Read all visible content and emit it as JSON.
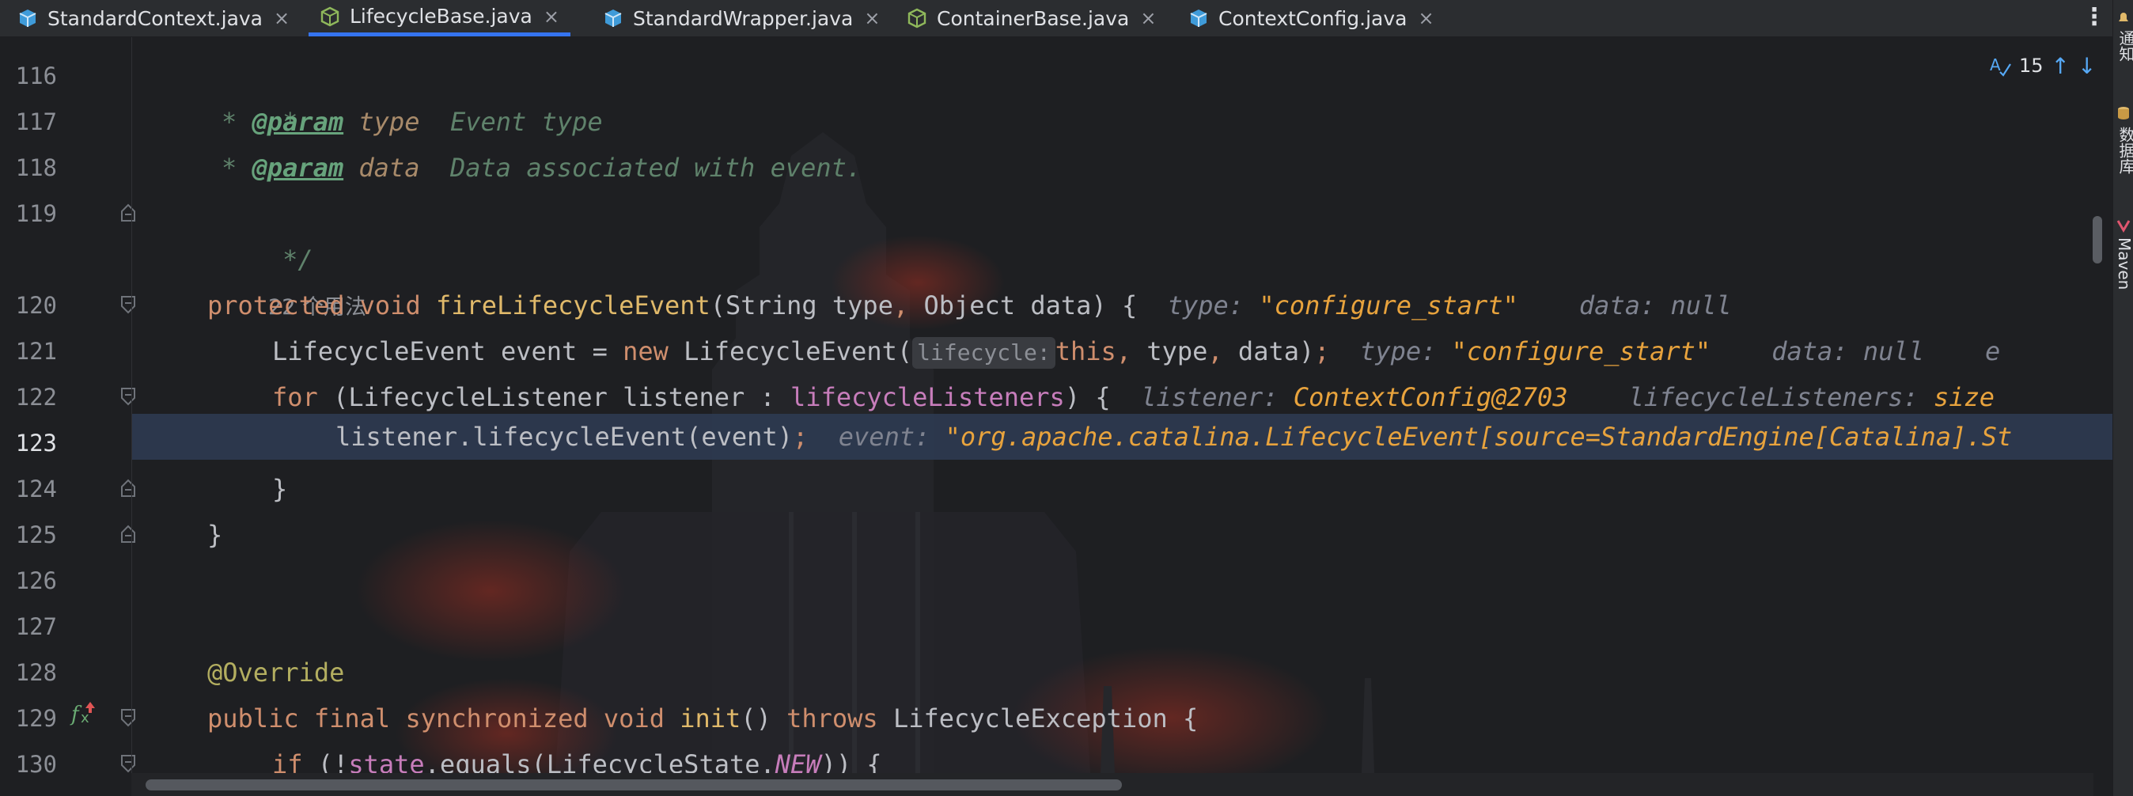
{
  "tabs": [
    {
      "label": "StandardContext.java",
      "icon": "java-class-icon"
    },
    {
      "label": "LifecycleBase.java",
      "icon": "java-abstract-class-icon"
    },
    {
      "label": "StandardWrapper.java",
      "icon": "java-class-icon"
    },
    {
      "label": "ContainerBase.java",
      "icon": "java-abstract-class-icon"
    },
    {
      "label": "ContextConfig.java",
      "icon": "java-class-icon"
    }
  ],
  "active_tab": "LifecycleBase.java",
  "close_glyph": "×",
  "more_glyph": "⋮",
  "inspection": {
    "count": "15",
    "up": "↑",
    "down": "↓"
  },
  "right_strip": [
    "通知",
    "数据库",
    "Maven"
  ],
  "line_numbers": [
    "116",
    "117",
    "118",
    "119",
    "120",
    "121",
    "122",
    "123",
    "124",
    "125",
    "126",
    "127",
    "128",
    "129",
    "130"
  ],
  "current_line": "123",
  "usage_hint": "22 个用法",
  "code": {
    "l116": {
      "star": "*"
    },
    "l117": {
      "star": "* ",
      "tag": "@param",
      "name": "type",
      "desc": "Event type"
    },
    "l118": {
      "star": "* ",
      "tag": "@param",
      "name": "data",
      "desc": "Data associated with event."
    },
    "l119": {
      "end": "*/"
    },
    "l120": {
      "kw1": "protected",
      "kw2": "void",
      "fn": "fireLifecycleEvent",
      "p1": "(String type",
      "comma": ",",
      "p2": " Object data) {",
      "d1k": "type: ",
      "d1v": "\"configure_start\"",
      "d2k": "data: ",
      "d2v": "null"
    },
    "l121": {
      "t": "LifecycleEvent event = ",
      "kw": "new",
      "t2": " LifecycleEvent(",
      "hint": "lifecycle:",
      "kw2": "this",
      "c1": ",",
      "t3": " type",
      "c2": ",",
      "t4": " data)",
      "semi": ";",
      "d1k": "type: ",
      "d1v": "\"configure_start\"",
      "d2k": "data: ",
      "d2v": "null",
      "d3k": "e"
    },
    "l122": {
      "kw": "for",
      "t": " (LifecycleListener listener : ",
      "fld": "lifecycleListeners",
      "t2": ") {",
      "d1k": "listener: ",
      "d1v": "ContextConfig@2703",
      "d2k": "lifecycleListeners: ",
      "d2v": "size"
    },
    "l123": {
      "t": "listener.lifecycleEvent(event)",
      "semi": ";",
      "d1k": "event: ",
      "d1v": "\"org.apache.catalina.LifecycleEvent[source=StandardEngine[Catalina].St"
    },
    "l124": {
      "t": "}"
    },
    "l125": {
      "t": "}"
    },
    "l128": {
      "ann": "@Override"
    },
    "l129": {
      "kw1": "public",
      "kw2": "final",
      "kw3": "synchronized",
      "kw4": "void",
      "fn": "init",
      "t": "() ",
      "kw5": "throws",
      "t2": " LifecycleException {"
    },
    "l130": {
      "kw": "if",
      "t": " (!",
      "fld": "state",
      "t2": ".equals(LifecycleState.",
      "stat": "NEW",
      "t3": ")) {"
    }
  },
  "colors": {
    "editor_bg": "#1e1f22",
    "tab_bar_bg": "#2b2d30",
    "keyword": "#cf8e6d",
    "function": "#56a8f5",
    "comment": "#5f826b",
    "debug_value": "#e8a33d",
    "current_line": "#2e3a50"
  }
}
